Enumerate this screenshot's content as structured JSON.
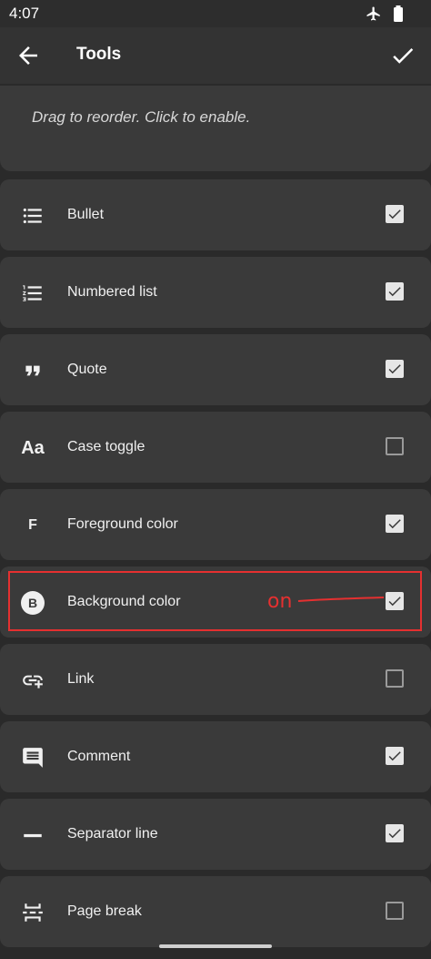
{
  "status_bar": {
    "time": "4:07",
    "icons": [
      "airplane-icon",
      "battery-icon"
    ]
  },
  "app_bar": {
    "title": "Tools",
    "back_icon": "arrow-left-icon",
    "confirm_icon": "check-icon"
  },
  "hint": "Drag to reorder. Click to enable.",
  "tools": [
    {
      "label": "Bullet",
      "icon": "bullet-list-icon",
      "enabled": true
    },
    {
      "label": "Numbered list",
      "icon": "numbered-list-icon",
      "enabled": true
    },
    {
      "label": "Quote",
      "icon": "quote-icon",
      "enabled": true
    },
    {
      "label": "Case toggle",
      "icon": "case-toggle-icon",
      "icon_text": "Aa",
      "enabled": false
    },
    {
      "label": "Foreground color",
      "icon": "foreground-color-icon",
      "icon_text": "F",
      "enabled": true
    },
    {
      "label": "Background color",
      "icon": "background-color-icon",
      "icon_text": "B",
      "enabled": true
    },
    {
      "label": "Link",
      "icon": "link-add-icon",
      "enabled": false
    },
    {
      "label": "Comment",
      "icon": "comment-icon",
      "enabled": true
    },
    {
      "label": "Separator line",
      "icon": "separator-line-icon",
      "enabled": true
    },
    {
      "label": "Page break",
      "icon": "page-break-icon",
      "enabled": false
    }
  ],
  "annotation": {
    "text": "on",
    "color": "#e53030"
  },
  "colors": {
    "background": "#2a2a2a",
    "card": "#3a3a3a",
    "app_bar": "#333333",
    "checkbox_checked": "#e6e6e6",
    "annotation": "#e53030"
  }
}
